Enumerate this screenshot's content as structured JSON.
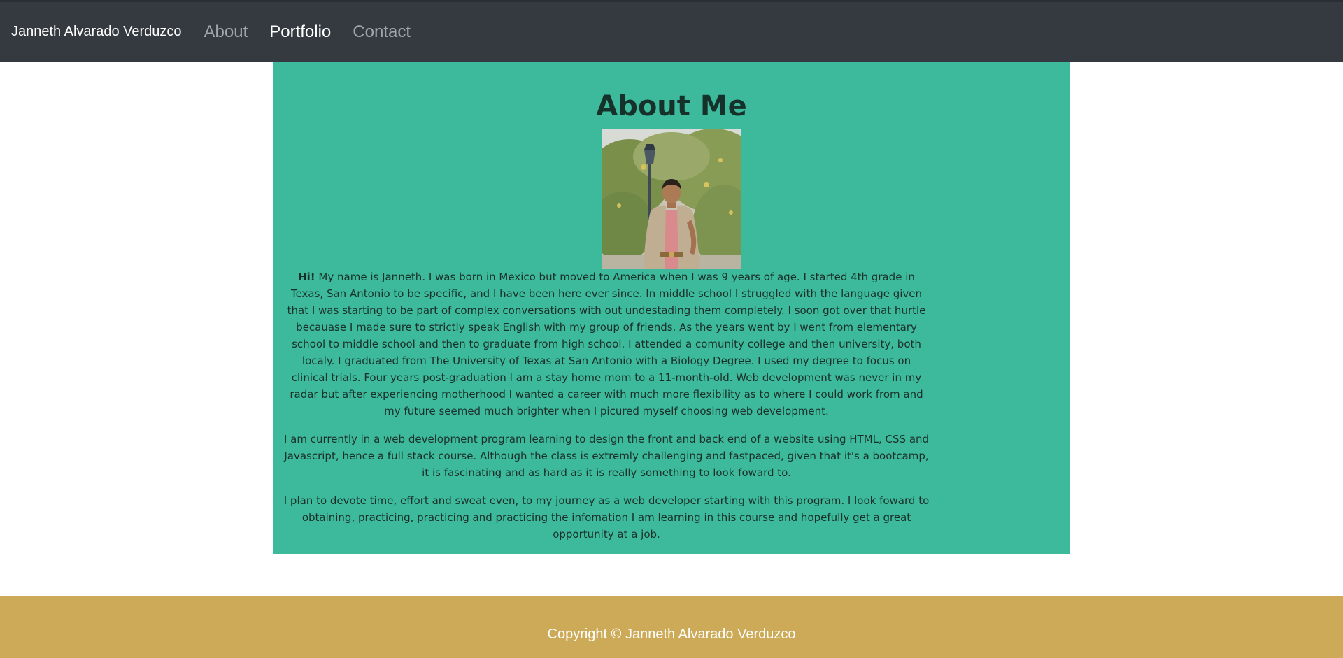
{
  "navbar": {
    "brand": "Janneth Alvarado Verduzco",
    "links": [
      {
        "label": "About"
      },
      {
        "label": "Portfolio"
      },
      {
        "label": "Contact"
      }
    ]
  },
  "about": {
    "title": "About Me",
    "photo_alt": "Portrait of Janneth",
    "intro_bold": "Hi!",
    "paragraph1": " My name is Janneth. I was born in Mexico but moved to America when I was 9 years of age. I started 4th grade in Texas, San Antonio to be specific, and I have been here ever since. In middle school I struggled with the language given that I was starting to be part of complex conversations with out undestading them completely. I soon got over that hurtle becauase I made sure to strictly speak English with my group of friends. As the years went by I went from elementary school to middle school and then to graduate from high school. I attended a comunity college and then university, both localy. I graduated from The University of Texas at San Antonio with a Biology Degree. I used my degree to focus on clinical trials. Four years post-graduation I am a stay home mom to a 11-month-old. Web development was never in my radar but after experiencing motherhood I wanted a career with much more flexibility as to where I could work from and my future seemed much brighter when I picured myself choosing web development.",
    "paragraph2": "I am currently in a web development program learning to design the front and back end of a website using HTML, CSS and Javascript, hence a full stack course. Although the class is extremly challenging and fastpaced, given that it's a bootcamp, it is fascinating and as hard as it is really something to look foward to.",
    "paragraph3": "I plan to devote time, effort and sweat even, to my journey as a web developer starting with this program. I look foward to obtaining, practicing, practicing and practicing the infomation I am learning in this course and hopefully get a great opportunity at a job."
  },
  "footer": {
    "copyright": "Copyright © Janneth Alvarado Verduzco"
  },
  "colors": {
    "navbar": "#343a40",
    "about_bg": "#3cba9b",
    "footer_bg": "#ccaa58"
  }
}
